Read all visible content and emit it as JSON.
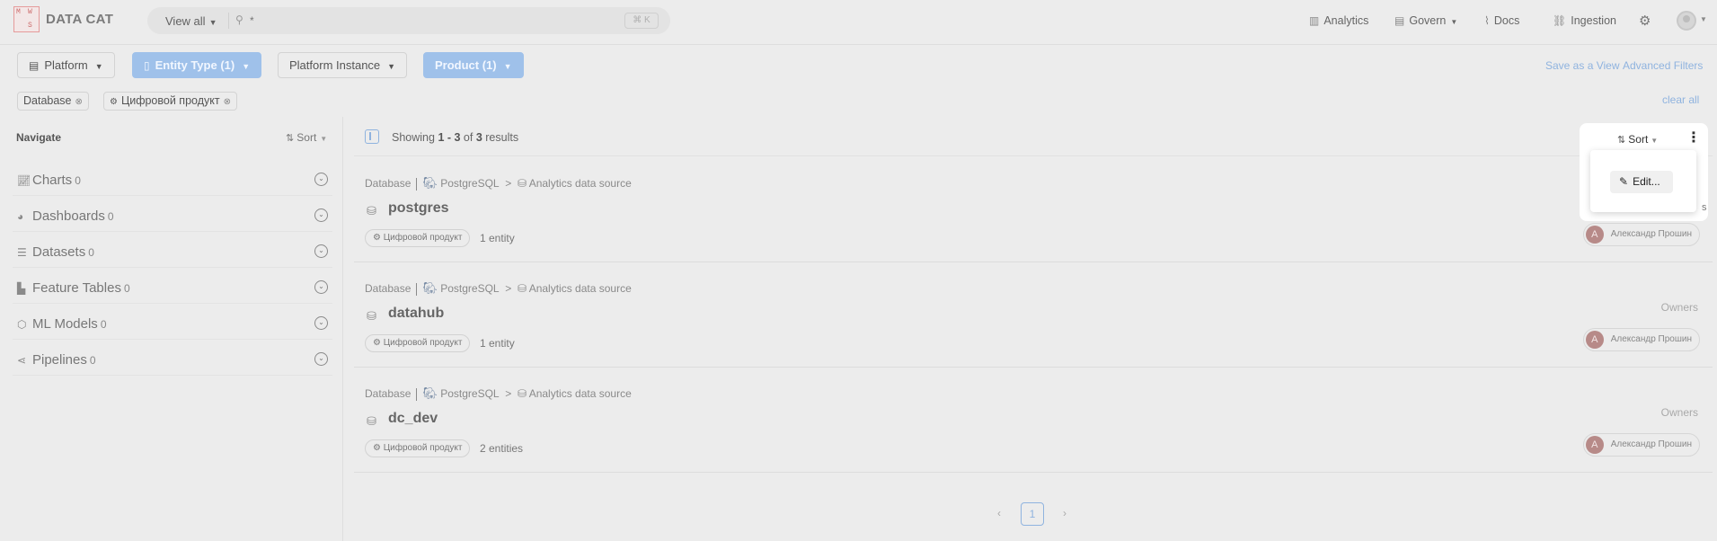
{
  "header": {
    "logo_letters": [
      "M",
      "W",
      "S"
    ],
    "app_name": "DATA CAT",
    "search": {
      "scope_label": "View all",
      "placeholder": "*",
      "shortcut": "⌘ K"
    },
    "nav": [
      {
        "label": "Analytics",
        "icon": "bar-chart-icon"
      },
      {
        "label": "Govern",
        "icon": "book-icon"
      },
      {
        "label": "Docs",
        "icon": "paperclip-icon"
      },
      {
        "label": "Ingestion",
        "icon": "link-icon"
      }
    ]
  },
  "filters": {
    "buttons": [
      {
        "label": "Platform",
        "active": false
      },
      {
        "label": "Entity Type (1)",
        "active": true
      },
      {
        "label": "Platform Instance",
        "active": false
      },
      {
        "label": "Product (1)",
        "active": true
      }
    ],
    "save_as_view": "Save as a View",
    "advanced_filters": "Advanced Filters",
    "chips": [
      "Database",
      "Цифровой продукт"
    ],
    "clear_all": "clear all"
  },
  "sidebar": {
    "title": "Navigate",
    "sort_label": "Sort",
    "items": [
      {
        "label": "Charts",
        "count": "0"
      },
      {
        "label": "Dashboards",
        "count": "0"
      },
      {
        "label": "Datasets",
        "count": "0"
      },
      {
        "label": "Feature Tables",
        "count": "0"
      },
      {
        "label": "ML Models",
        "count": "0"
      },
      {
        "label": "Pipelines",
        "count": "0"
      }
    ]
  },
  "results": {
    "showing_prefix": "Showing ",
    "range": "1 - 3",
    "of": " of ",
    "total": "3",
    "suffix": " results",
    "items": [
      {
        "type": "Database",
        "platform": "PostgreSQL",
        "source": "Analytics data source",
        "name": "postgres",
        "tag": "Цифровой продукт",
        "entities": "1 entity",
        "owners_label": "",
        "owner": "Александр Прошин",
        "owner_initial": "A"
      },
      {
        "type": "Database",
        "platform": "PostgreSQL",
        "source": "Analytics data source",
        "name": "datahub",
        "tag": "Цифровой продукт",
        "entities": "1 entity",
        "owners_label": "Owners",
        "owner": "Александр Прошин",
        "owner_initial": "A"
      },
      {
        "type": "Database",
        "platform": "PostgreSQL",
        "source": "Analytics data source",
        "name": "dc_dev",
        "tag": "Цифровой продукт",
        "entities": "2 entities",
        "owners_label": "Owners",
        "owner": "Александр Прошин",
        "owner_initial": "A"
      }
    ]
  },
  "pagination": {
    "prev": "‹",
    "current": "1",
    "next": "›"
  },
  "popover": {
    "sort_label": "Sort",
    "edit_label": "Edit...",
    "partial_text": "s"
  }
}
